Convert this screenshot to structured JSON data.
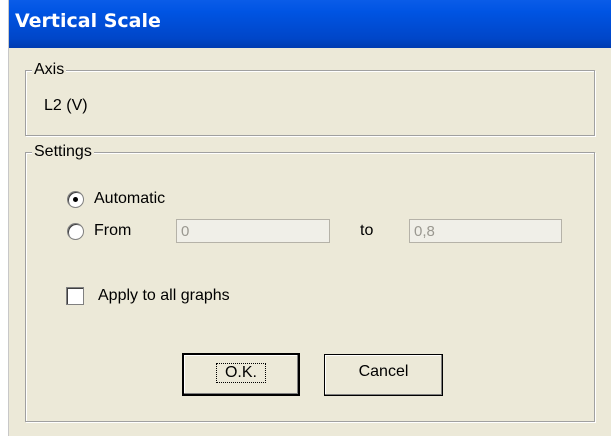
{
  "window": {
    "title": "Vertical Scale"
  },
  "axis_group": {
    "legend": "Axis",
    "value": "L2 (V)"
  },
  "settings_group": {
    "legend": "Settings",
    "radio_automatic": {
      "label": "Automatic",
      "selected": true
    },
    "radio_from": {
      "label": "From",
      "selected": false
    },
    "from_value": "0",
    "to_label": "to",
    "to_value": "0,8",
    "apply_all": {
      "label": "Apply to all graphs",
      "checked": false
    }
  },
  "buttons": {
    "ok_label": "O.K.",
    "cancel_label": "Cancel"
  },
  "colors": {
    "titlebar": "#0054e3",
    "dialog_background": "#ece9d8",
    "disabled_text": "#9a9890"
  }
}
